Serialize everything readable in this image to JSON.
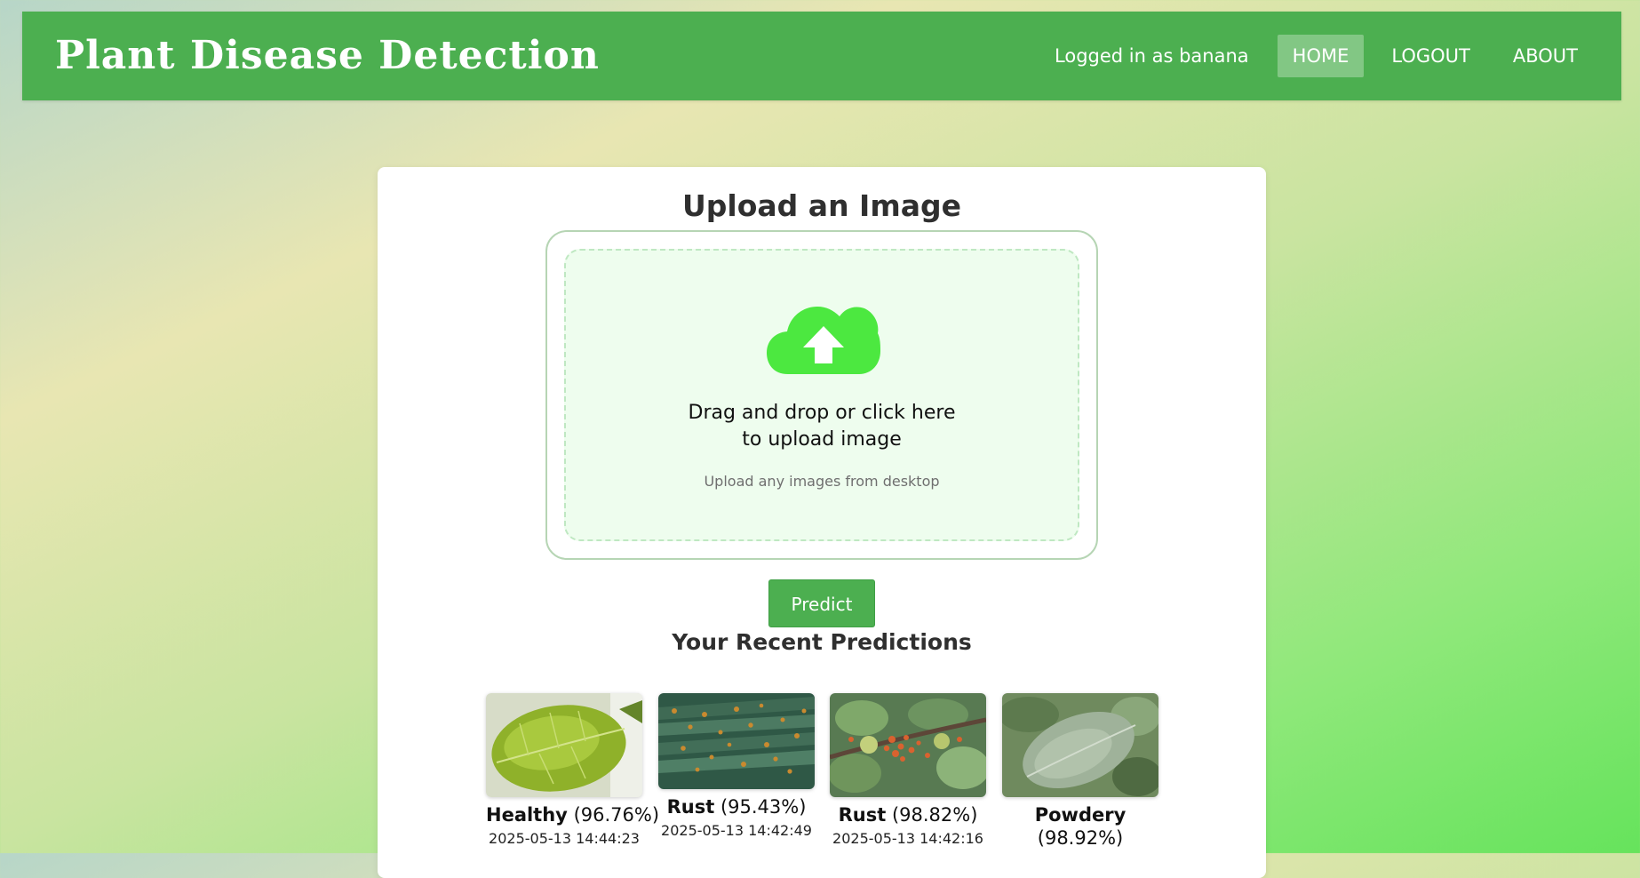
{
  "app": {
    "title": "Plant Disease Detection"
  },
  "nav": {
    "user_text": "Logged in as banana",
    "links": [
      {
        "label": "HOME",
        "active": true
      },
      {
        "label": "LOGOUT",
        "active": false
      },
      {
        "label": "ABOUT",
        "active": false
      }
    ]
  },
  "upload": {
    "heading": "Upload an Image",
    "main_line1": "Drag and drop or click here",
    "main_line2": "to upload image",
    "sub_text": "Upload any images from desktop",
    "icon": "cloud-upload-icon"
  },
  "predict_button": "Predict",
  "recent": {
    "heading": "Your Recent Predictions",
    "items": [
      {
        "label": "Healthy",
        "confidence": "(96.76%)",
        "date": "2025-05-13 14:44:23"
      },
      {
        "label": "Rust",
        "confidence": "(95.43%)",
        "date": "2025-05-13 14:42:49"
      },
      {
        "label": "Rust",
        "confidence": "(98.82%)",
        "date": "2025-05-13 14:42:16"
      },
      {
        "label": "Powdery",
        "confidence": "(98.92%)",
        "date": ""
      }
    ]
  },
  "colors": {
    "primary": "#4caf50",
    "upload_icon": "#4ce840",
    "card": "#ffffff"
  }
}
